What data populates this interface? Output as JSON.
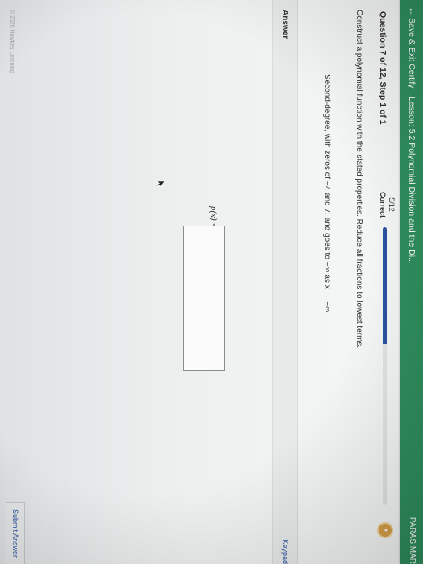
{
  "topbar": {
    "back_glyph": "←",
    "save_label": "Save & Exit Certify",
    "lesson_title": "Lesson: 5.2 Polynomial Division and the Di...",
    "user_name": "PARAS MAR",
    "bg_color": "#2f8f5e"
  },
  "question": {
    "header": "Question 7 of 12, Step 1 of 1",
    "score": "5/12",
    "score_label": "Correct",
    "progress_fraction": 0.42,
    "progress_color": "#2b53a1",
    "instruction": "Construct a polynomial function with the stated properties. Reduce all fractions to lowest terms.",
    "properties": "Second-degree, with zeros of −4 and 7, and goes to −∞ as x → −∞."
  },
  "answer": {
    "label": "Answer",
    "keypad": "Keypad",
    "fx_label": "p(x) =",
    "value": ""
  },
  "footer": {
    "copyright": "© 2020 Hawkes Learning",
    "submit_label": "Submit Answer"
  }
}
